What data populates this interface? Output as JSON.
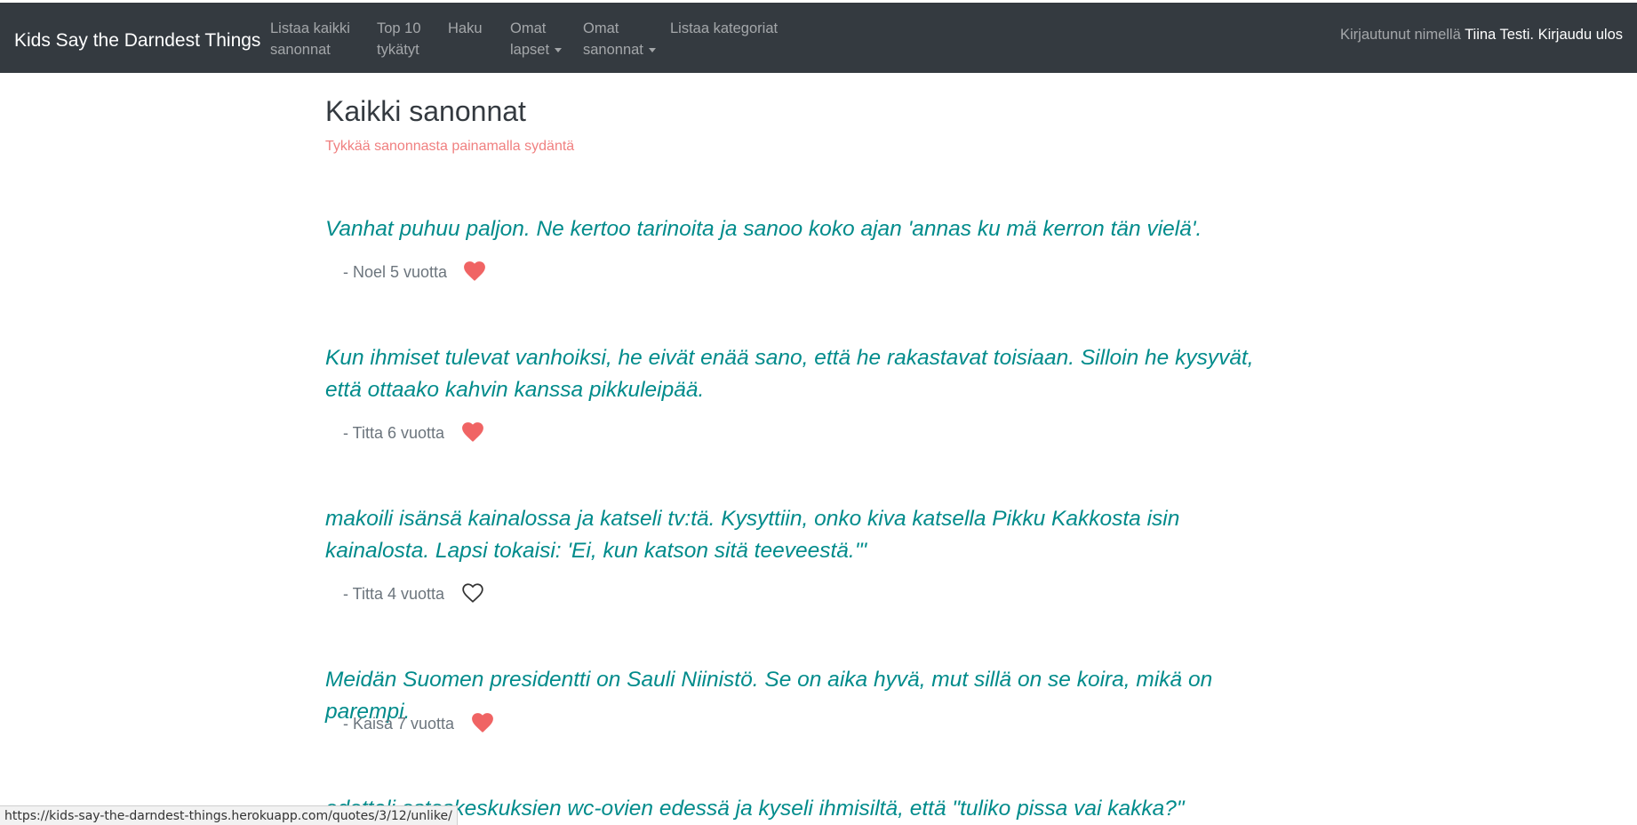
{
  "navbar": {
    "brand": "Kids Say the Darndest Things",
    "items": [
      {
        "line1": "Listaa kaikki",
        "line2": "sanonnat",
        "dropdown": false
      },
      {
        "line1": "Top 10",
        "line2": "tykätyt",
        "dropdown": false
      },
      {
        "line1": "Haku",
        "line2": "",
        "dropdown": false
      },
      {
        "line1": "Omat",
        "line2": "lapset",
        "dropdown": true
      },
      {
        "line1": "Omat",
        "line2": "sanonnat",
        "dropdown": true
      },
      {
        "line1": "Listaa kategoriat",
        "line2": "",
        "dropdown": false
      }
    ],
    "logged_in_prefix": "Kirjautunut nimellä",
    "user_name": "Tiina Testi.",
    "logout_label": "Kirjaudu ulos"
  },
  "main": {
    "title": "Kaikki sanonnat",
    "subtitle": "Tykkää sanonnasta painamalla sydäntä",
    "quotes": [
      {
        "text": "Vanhat puhuu paljon. Ne kertoo tarinoita ja sanoo koko ajan 'annas ku mä kerron tän vielä'.",
        "author": "- Noel 5 vuotta",
        "liked": true
      },
      {
        "text": "Kun ihmiset tulevat vanhoiksi, he eivät enää sano, että he rakastavat toisiaan. Silloin he kysyvät, että ottaako kahvin kanssa pikkuleipää.",
        "author": "- Titta 6 vuotta",
        "liked": true
      },
      {
        "text": "makoili isänsä kainalossa ja katseli tv:tä. Kysyttiin, onko kiva katsella Pikku Kakkosta isin kainalosta. Lapsi tokaisi: 'Ei, kun katson sitä teeveestä.'\"",
        "author": "- Titta 4 vuotta",
        "liked": false
      },
      {
        "text": "Meidän Suomen presidentti on Sauli Niinistö. Se on aika hyvä, mut sillä on se koira, mikä on parempi.",
        "author": "- Kaisa 7 vuotta",
        "liked": true
      },
      {
        "text": "odotteli ostoskeskuksien wc-ovien edessä ja kyseli ihmisiltä, että \"tuliko pissa vai kakka?\"",
        "author": "",
        "liked": null
      }
    ]
  },
  "status_bar": {
    "url": "https://kids-say-the-darndest-things.herokuapp.com/quotes/3/12/unlike/"
  },
  "colors": {
    "navbar_bg": "#343a40",
    "quote_text": "#008b8b",
    "subtitle": "#f08080",
    "heart_filled": "#f06464",
    "heart_outline": "#333333"
  },
  "icons": {
    "liked": "heart-filled-icon",
    "not_liked": "heart-outline-icon"
  }
}
